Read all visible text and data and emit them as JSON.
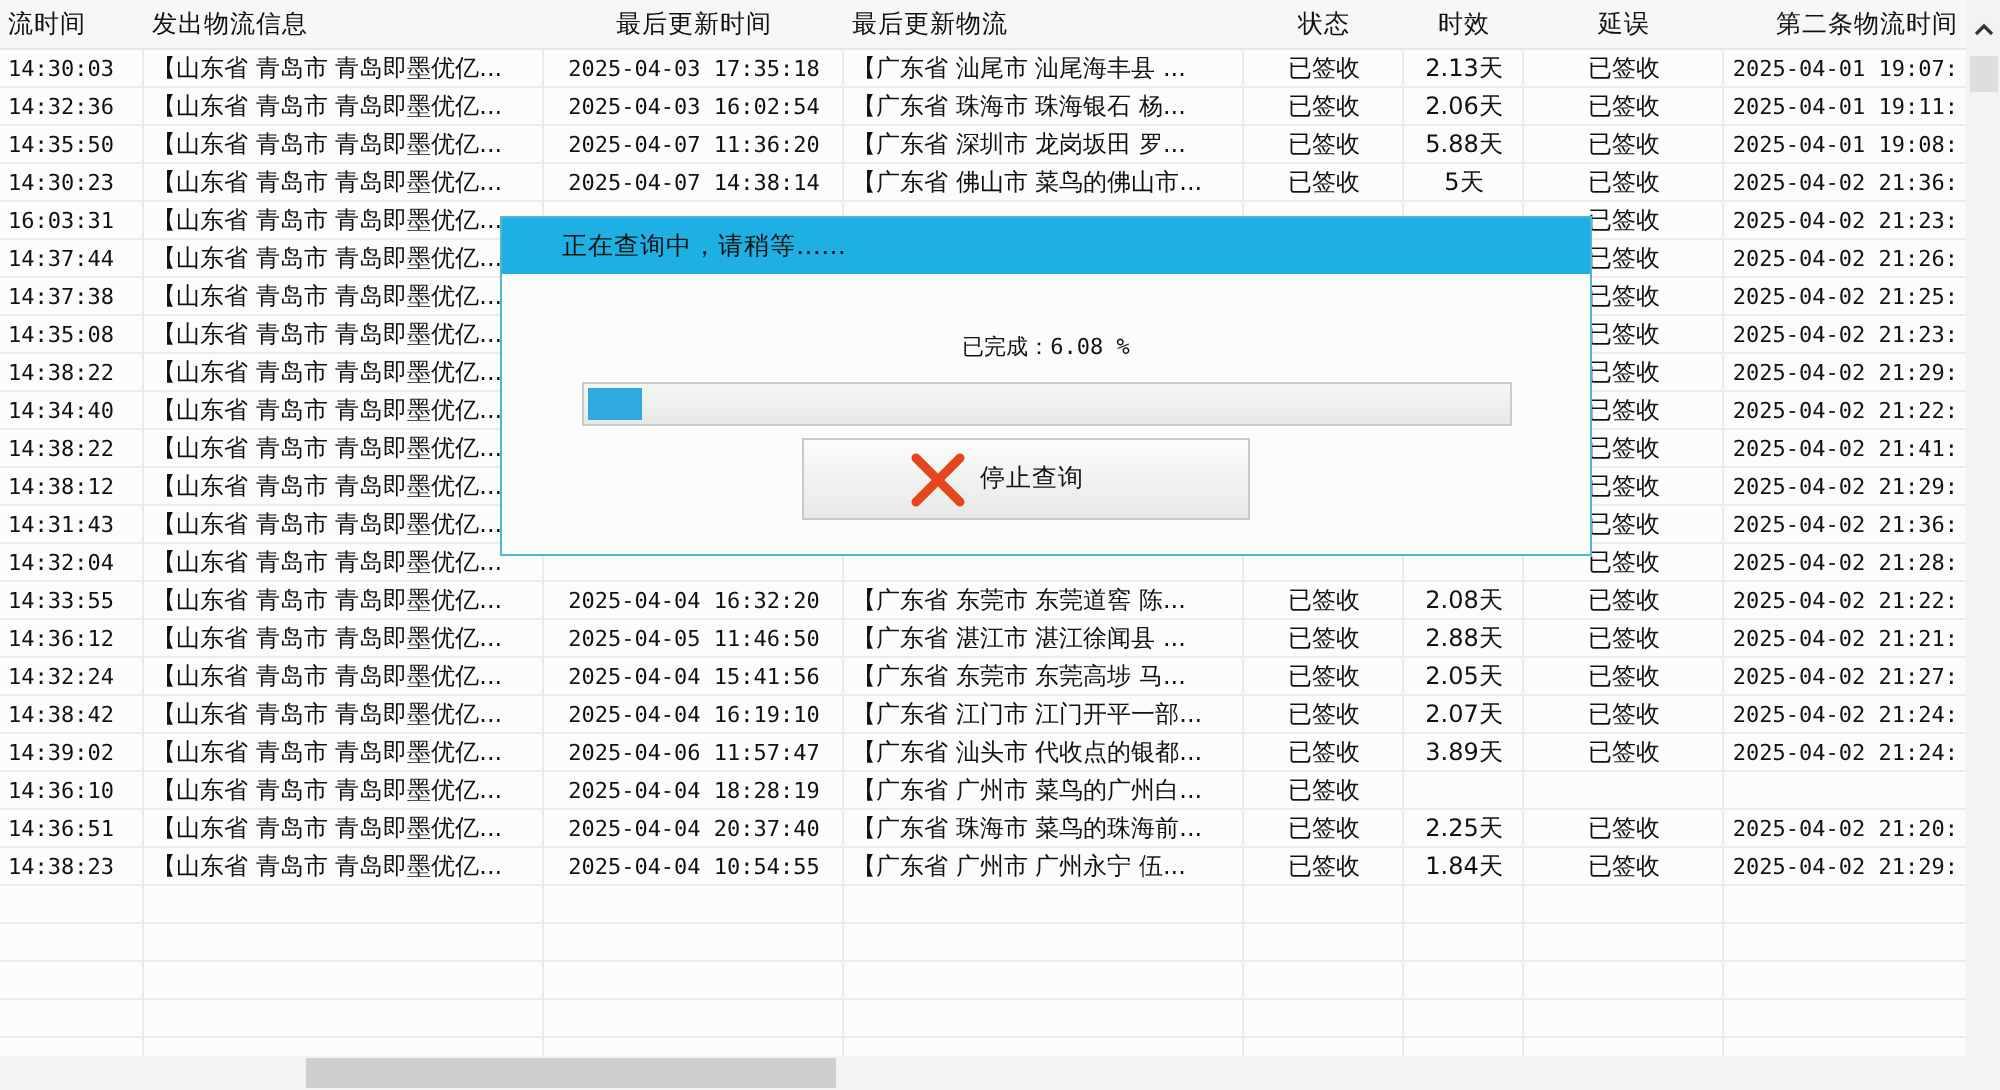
{
  "table": {
    "columns": [
      "流时间",
      "发出物流信息",
      "最后更新时间",
      "最后更新物流",
      "状态",
      "时效",
      "延误",
      "第二条物流时间"
    ],
    "rows": [
      [
        "14:30:03",
        "【山东省 青岛市 青岛即墨优亿...",
        "2025-04-03 17:35:18",
        "【广东省 汕尾市 汕尾海丰县 ...",
        "已签收",
        "2.13天",
        "已签收",
        "2025-04-01 19:07:"
      ],
      [
        "14:32:36",
        "【山东省 青岛市 青岛即墨优亿...",
        "2025-04-03 16:02:54",
        "【广东省 珠海市 珠海银石 杨...",
        "已签收",
        "2.06天",
        "已签收",
        "2025-04-01 19:11:"
      ],
      [
        "14:35:50",
        "【山东省 青岛市 青岛即墨优亿...",
        "2025-04-07 11:36:20",
        "【广东省 深圳市 龙岗坂田 罗...",
        "已签收",
        "5.88天",
        "已签收",
        "2025-04-01 19:08:"
      ],
      [
        "14:30:23",
        "【山东省 青岛市 青岛即墨优亿...",
        "2025-04-07 14:38:14",
        "【广东省 佛山市 菜鸟的佛山市...",
        "已签收",
        "5天",
        "已签收",
        "2025-04-02 21:36:"
      ],
      [
        "16:03:31",
        "【山东省 青岛市 青岛即墨优亿...",
        null,
        null,
        null,
        null,
        "已签收",
        "2025-04-02 21:23:"
      ],
      [
        "14:37:44",
        "【山东省 青岛市 青岛即墨优亿...",
        null,
        null,
        null,
        null,
        "已签收",
        "2025-04-02 21:26:"
      ],
      [
        "14:37:38",
        "【山东省 青岛市 青岛即墨优亿...",
        null,
        null,
        null,
        null,
        "已签收",
        "2025-04-02 21:25:"
      ],
      [
        "14:35:08",
        "【山东省 青岛市 青岛即墨优亿...",
        null,
        null,
        null,
        null,
        "已签收",
        "2025-04-02 21:23:"
      ],
      [
        "14:38:22",
        "【山东省 青岛市 青岛即墨优亿...",
        null,
        null,
        null,
        null,
        "已签收",
        "2025-04-02 21:29:"
      ],
      [
        "14:34:40",
        "【山东省 青岛市 青岛即墨优亿...",
        null,
        null,
        null,
        null,
        "已签收",
        "2025-04-02 21:22:"
      ],
      [
        "14:38:22",
        "【山东省 青岛市 青岛即墨优亿...",
        null,
        null,
        null,
        null,
        "已签收",
        "2025-04-02 21:41:"
      ],
      [
        "14:38:12",
        "【山东省 青岛市 青岛即墨优亿...",
        null,
        null,
        null,
        null,
        "已签收",
        "2025-04-02 21:29:"
      ],
      [
        "14:31:43",
        "【山东省 青岛市 青岛即墨优亿...",
        null,
        null,
        null,
        null,
        "已签收",
        "2025-04-02 21:36:"
      ],
      [
        "14:32:04",
        "【山东省 青岛市 青岛即墨优亿...",
        null,
        null,
        null,
        null,
        "已签收",
        "2025-04-02 21:28:"
      ],
      [
        "14:33:55",
        "【山东省 青岛市 青岛即墨优亿...",
        "2025-04-04 16:32:20",
        "【广东省 东莞市 东莞道窖 陈...",
        "已签收",
        "2.08天",
        "已签收",
        "2025-04-02 21:22:"
      ],
      [
        "14:36:12",
        "【山东省 青岛市 青岛即墨优亿...",
        "2025-04-05 11:46:50",
        "【广东省 湛江市 湛江徐闻县 ...",
        "已签收",
        "2.88天",
        "已签收",
        "2025-04-02 21:21:"
      ],
      [
        "14:32:24",
        "【山东省 青岛市 青岛即墨优亿...",
        "2025-04-04 15:41:56",
        "【广东省 东莞市 东莞高埗 马...",
        "已签收",
        "2.05天",
        "已签收",
        "2025-04-02 21:27:"
      ],
      [
        "14:38:42",
        "【山东省 青岛市 青岛即墨优亿...",
        "2025-04-04 16:19:10",
        "【广东省 江门市 江门开平一部...",
        "已签收",
        "2.07天",
        "已签收",
        "2025-04-02 21:24:"
      ],
      [
        "14:39:02",
        "【山东省 青岛市 青岛即墨优亿...",
        "2025-04-06 11:57:47",
        "【广东省 汕头市 代收点的银都...",
        "已签收",
        "3.89天",
        "已签收",
        "2025-04-02 21:24:"
      ],
      [
        "14:36:10",
        "【山东省 青岛市 青岛即墨优亿...",
        "2025-04-04 18:28:19",
        "【广东省 广州市 菜鸟的广州白...",
        "已签收",
        null,
        null,
        null
      ],
      [
        "14:36:51",
        "【山东省 青岛市 青岛即墨优亿...",
        "2025-04-04 20:37:40",
        "【广东省 珠海市 菜鸟的珠海前...",
        "已签收",
        "2.25天",
        "已签收",
        "2025-04-02 21:20:"
      ],
      [
        "14:38:23",
        "【山东省 青岛市 青岛即墨优亿...",
        "2025-04-04 10:54:55",
        "【广东省 广州市 广州永宁 伍...",
        "已签收",
        "1.84天",
        "已签收",
        "2025-04-02 21:29:"
      ]
    ]
  },
  "dialog": {
    "title": "正在查询中，请稍等……",
    "status": "已完成：6.08 %",
    "progress": {
      "level": 0.06
    },
    "button": "停止查询"
  }
}
